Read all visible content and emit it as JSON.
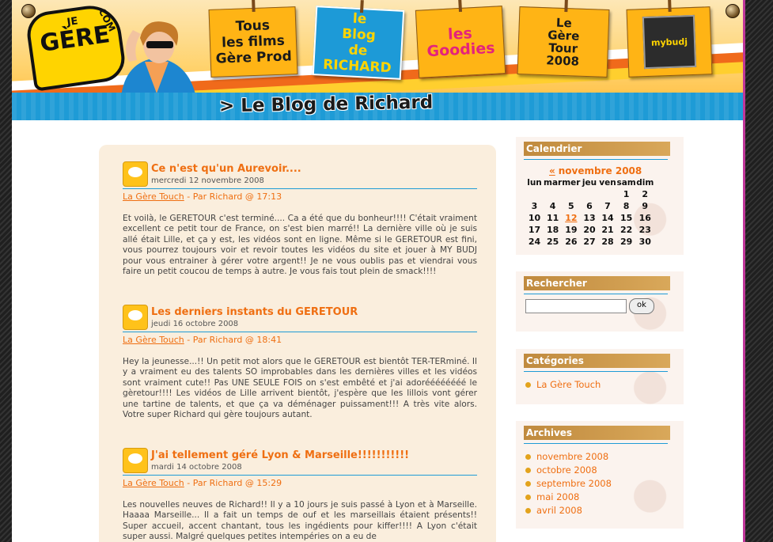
{
  "header": {
    "logo": {
      "line1": "JE",
      "line2": "GÈRE",
      "suffix": ".COM"
    },
    "nav": [
      {
        "label": "Tous\nles films\nGère Prod"
      },
      {
        "label": "le\nBlog\nde RICHARD"
      },
      {
        "label": "les\nGoodies"
      },
      {
        "label": "Le\nGère\nTour\n2008"
      },
      {
        "label": "mybudj"
      }
    ],
    "page_title": "> Le Blog de Richard"
  },
  "posts": [
    {
      "title": "Ce n'est qu'un Aurevoir....",
      "date": "mercredi 12 novembre 2008",
      "category": "La Gère Touch",
      "meta": " - Par Richard @ 17:13",
      "body": "Et voilà, le GERETOUR c'est terminé.... Ca a été que du bonheur!!!! C'était vraiment excellent ce petit tour de France, on s'est bien marré!! La dernière ville où je suis allé était Lille, et ça y est, les vidéos sont en ligne. Même si le GERETOUR est fini, vous pourrez toujours voir et revoir toutes les vidéos du site et jouer à MY BUDJ pour vous entrainer à gérer votre argent!! Je ne vous oublis pas et viendrai vous faire un petit coucou de temps à autre. Je vous fais tout plein de smack!!!!"
    },
    {
      "title": "Les derniers instants du GERETOUR",
      "date": "jeudi 16 octobre 2008",
      "category": "La Gère Touch",
      "meta": " - Par Richard @ 18:41",
      "body": "Hey la jeunesse...!! Un petit mot alors que le GERETOUR est bientôt TER-TERminé. Il y a vraiment eu des talents SO improbables dans les dernières villes et les vidéos sont vraiment cute!! Pas UNE SEULE FOIS on s'est embêté et j'ai adoréééééééé le gèretour!!!! Les vidéos de Lille arrivent bientôt, j'espère que les lillois vont gérer une tartine de talents, et que ça va déménager puissament!!! A très vite alors. Votre super Richard qui gère toujours autant."
    },
    {
      "title": "J'ai tellement géré Lyon & Marseille!!!!!!!!!!!",
      "date": "mardi 14 octobre 2008",
      "category": "La Gère Touch",
      "meta": " - Par Richard @ 15:29",
      "body": "Les nouvelles neuves de Richard!! Il y a 10 jours je suis passé à Lyon et à Marseille. Haaaa Marseille... Il a fait un temps de ouf et les marseillais étaient présents!! Super accueil, accent chantant, tous les ingédients pour kiffer!!!! A Lyon c'était super aussi. Malgré quelques petites intempéries on a eu de"
    }
  ],
  "sidebar": {
    "calendar": {
      "title": "Calendrier",
      "prev": "«",
      "month": "novembre 2008",
      "weekdays": [
        "lun",
        "mar",
        "mer",
        "jeu",
        "ven",
        "sam",
        "dim"
      ],
      "weeks": [
        [
          "",
          "",
          "",
          "",
          "",
          "1",
          "2"
        ],
        [
          "3",
          "4",
          "5",
          "6",
          "7",
          "8",
          "9"
        ],
        [
          "10",
          "11",
          "12",
          "13",
          "14",
          "15",
          "16"
        ],
        [
          "17",
          "18",
          "19",
          "20",
          "21",
          "22",
          "23"
        ],
        [
          "24",
          "25",
          "26",
          "27",
          "28",
          "29",
          "30"
        ]
      ],
      "linked_day": "12"
    },
    "search": {
      "title": "Rechercher",
      "placeholder": "",
      "button": "ok"
    },
    "categories": {
      "title": "Catégories",
      "items": [
        "La Gère Touch"
      ]
    },
    "archives": {
      "title": "Archives",
      "items": [
        "novembre 2008",
        "octobre 2008",
        "septembre 2008",
        "mai 2008",
        "avril 2008"
      ]
    }
  },
  "colors": {
    "accent_orange": "#ef6f12",
    "accent_blue": "#1e9bd6",
    "panel_beige": "#faeedd"
  }
}
